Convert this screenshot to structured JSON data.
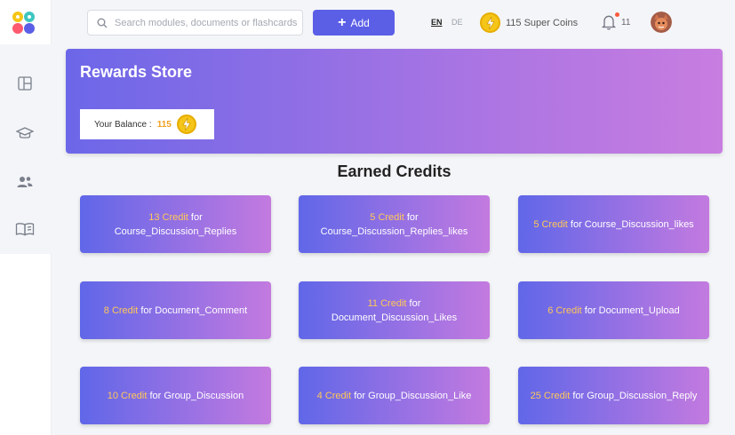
{
  "search": {
    "placeholder": "Search modules, documents or flashcards"
  },
  "add_button": {
    "label": "Add"
  },
  "lang": {
    "en": "EN",
    "de": "DE"
  },
  "coins": {
    "label": "115 Super Coins"
  },
  "notifications": {
    "count": "11"
  },
  "hero": {
    "title": "Rewards Store",
    "balance_label": "Your Balance :",
    "balance_value": "115"
  },
  "section": {
    "title": "Earned Credits"
  },
  "cards": [
    {
      "amount": "13 Credit",
      "text": "for Course_Discussion_Replies"
    },
    {
      "amount": "5 Credit",
      "text": "for Course_Discussion_Replies_likes"
    },
    {
      "amount": "5 Credit",
      "text": "for Course_Discussion_likes"
    },
    {
      "amount": "8 Credit",
      "text": "for Document_Comment"
    },
    {
      "amount": "11 Credit",
      "text": "for Document_Discussion_Likes"
    },
    {
      "amount": "6 Credit",
      "text": "for Document_Upload"
    },
    {
      "amount": "10 Credit",
      "text": "for Group_Discussion"
    },
    {
      "amount": "4 Credit",
      "text": "for Group_Discussion_Like"
    },
    {
      "amount": "25 Credit",
      "text": "for Group_Discussion_Reply"
    }
  ],
  "sidebar": {
    "items": [
      "dashboard-icon",
      "graduation-cap-icon",
      "users-icon",
      "book-icon"
    ]
  },
  "colors": {
    "primary": "#5b5fe6",
    "accent": "#ffc857",
    "gradient_start": "#6067e8",
    "gradient_end": "#c37adf"
  }
}
